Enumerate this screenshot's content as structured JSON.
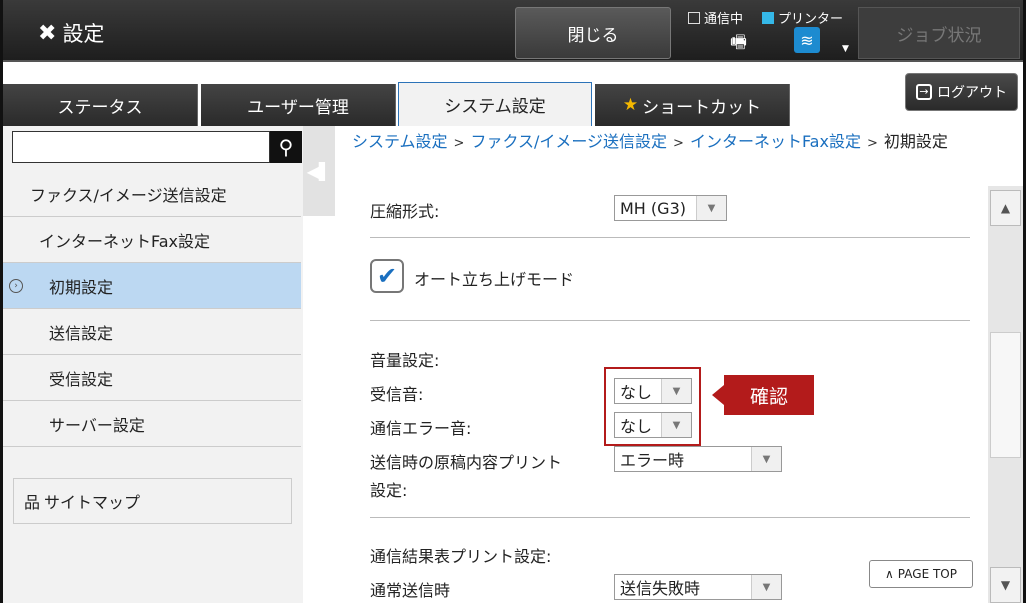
{
  "header": {
    "title": "設定",
    "close_label": "閉じる",
    "status_comm": "通信中",
    "status_printer": "プリンター",
    "job_status_label": "ジョブ状況",
    "accent_color": "#35b8e8"
  },
  "tabs": [
    {
      "label": "ステータス"
    },
    {
      "label": "ユーザー管理"
    },
    {
      "label": "システム設定"
    },
    {
      "label": "ショートカット"
    }
  ],
  "logout_label": "ログアウト",
  "sidebar": {
    "search": {
      "value": "",
      "placeholder": ""
    },
    "items": [
      {
        "label": "ファクス/イメージ送信設定"
      },
      {
        "label": "インターネットFax設定"
      },
      {
        "label": "初期設定"
      },
      {
        "label": "送信設定"
      },
      {
        "label": "受信設定"
      },
      {
        "label": "サーバー設定"
      }
    ],
    "sitemap_label": "サイトマップ"
  },
  "breadcrumb": {
    "items": [
      "システム設定",
      "ファクス/イメージ送信設定",
      "インターネットFax設定"
    ],
    "current": "初期設定"
  },
  "main": {
    "compression_label": "圧縮形式:",
    "compression_value": "MH (G3)",
    "auto_start_label": "オート立ち上げモード",
    "auto_start_checked": true,
    "volume_heading": "音量設定:",
    "receive_sound_label": "受信音:",
    "receive_sound_value": "なし",
    "error_sound_label": "通信エラー音:",
    "error_sound_value": "なし",
    "original_print_label_1": "送信時の原稿内容プリント",
    "original_print_label_2": "設定:",
    "original_print_value": "エラー時",
    "report_heading": "通信結果表プリント設定:",
    "normal_send_label": "通常送信時",
    "normal_send_value": "送信失敗時",
    "confirm_label": "確認",
    "confirm_color": "#b31b1b",
    "page_top_label": "PAGE TOP"
  }
}
